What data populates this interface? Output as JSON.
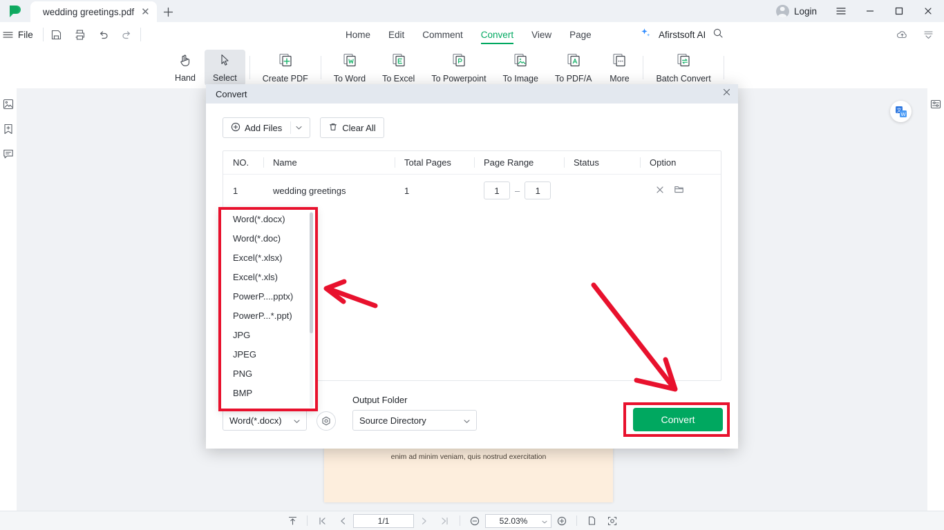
{
  "titlebar": {
    "logo_icon": "pdf-app-logo",
    "tab": {
      "label": "wedding greetings.pdf",
      "close_icon": "close-icon"
    },
    "new_tab_icon": "plus-icon",
    "login_label": "Login",
    "menu_icon": "hamburger-menu-icon",
    "minimize_icon": "minimize-icon",
    "maximize_icon": "maximize-icon",
    "close_icon": "close-icon"
  },
  "menubar": {
    "hamburger_icon": "list-menu-icon",
    "file_label": "File",
    "quick_icons": [
      "save-icon",
      "print-icon",
      "undo-icon",
      "redo-icon"
    ],
    "tabs": [
      {
        "label": "Home",
        "active": false
      },
      {
        "label": "Edit",
        "active": false
      },
      {
        "label": "Comment",
        "active": false
      },
      {
        "label": "Convert",
        "active": true
      },
      {
        "label": "View",
        "active": false
      },
      {
        "label": "Page",
        "active": false
      }
    ],
    "ai_label": "Afirstsoft AI",
    "ai_icon": "sparkle-icon",
    "search_icon": "search-icon",
    "cloud_icon": "cloud-upload-icon",
    "collapse_icon": "collapse-ribbon-icon"
  },
  "toolbar": {
    "items": [
      {
        "label": "Hand",
        "icon": "hand-icon",
        "selected": false
      },
      {
        "label": "Select",
        "icon": "cursor-arrow-icon",
        "selected": true
      },
      {
        "label": "Create PDF",
        "icon": "create-pdf-icon",
        "selected": false
      },
      {
        "label": "To Word",
        "icon": "to-word-icon",
        "selected": false
      },
      {
        "label": "To Excel",
        "icon": "to-excel-icon",
        "selected": false
      },
      {
        "label": "To Powerpoint",
        "icon": "to-powerpoint-icon",
        "selected": false
      },
      {
        "label": "To Image",
        "icon": "to-image-icon",
        "selected": false
      },
      {
        "label": "To PDF/A",
        "icon": "to-pdfa-icon",
        "selected": false
      },
      {
        "label": "More",
        "icon": "more-icon",
        "selected": false
      },
      {
        "label": "Batch Convert",
        "icon": "batch-convert-icon",
        "selected": false
      }
    ]
  },
  "left_rail": {
    "icons": [
      "thumbnail-icon",
      "bookmark-add-icon",
      "comment-icon"
    ]
  },
  "right_rail": {
    "icons": [
      "properties-sliders-icon"
    ],
    "translate_badge_icon": "translate-to-word-icon"
  },
  "document": {
    "visible_text": "enim ad minim veniam, quis nostrud exercitation",
    "page_color": "#fdeedd"
  },
  "dialog": {
    "title": "Convert",
    "close_icon": "close-icon",
    "add_files_label": "Add Files",
    "add_files_icon": "plus-circle-icon",
    "add_files_caret": "chevron-down-icon",
    "clear_all_label": "Clear All",
    "clear_all_icon": "trash-icon",
    "table": {
      "headers": [
        "NO.",
        "Name",
        "Total Pages",
        "Page Range",
        "Status",
        "Option"
      ],
      "rows": [
        {
          "no": "1",
          "name": "wedding greetings",
          "total_pages": "1",
          "range_from": "1",
          "range_to": "1",
          "range_dash": "–",
          "status": "",
          "option_icons": [
            "remove-file-icon",
            "open-folder-icon"
          ]
        }
      ]
    },
    "format_select": {
      "value": "Word(*.docx)",
      "caret_icon": "chevron-down-icon"
    },
    "settings_icon": "settings-gear-icon",
    "output_folder": {
      "label": "Output Folder",
      "value": "Source Directory",
      "caret_icon": "chevron-down-icon"
    },
    "convert_button": {
      "label": "Convert",
      "color": "#00a860"
    },
    "format_dropdown": {
      "options": [
        "Word(*.docx)",
        "Word(*.doc)",
        "Excel(*.xlsx)",
        "Excel(*.xls)",
        "PowerP....pptx)",
        "PowerP...*.ppt)",
        "JPG",
        "JPEG",
        "PNG",
        "BMP"
      ]
    }
  },
  "statusbar": {
    "fit_icon": "fit-page-icon",
    "first_icon": "first-page-icon",
    "prev_icon": "previous-page-icon",
    "page_value": "1/1",
    "next_icon": "next-page-icon",
    "last_icon": "last-page-icon",
    "zoom_out_icon": "zoom-out-icon",
    "zoom_value": "52.03%",
    "zoom_caret_icon": "chevron-down-icon",
    "zoom_in_icon": "zoom-in-icon",
    "single_page_icon": "single-page-view-icon",
    "snapshot_icon": "snapshot-icon"
  },
  "annotations": {
    "color": "#e8112d",
    "dropdown_highlight": "red-box-around-format-dropdown",
    "convert_highlight": "red-box-around-convert-button",
    "arrow_to_dropdown": "red-arrow-pointing-left",
    "arrow_to_convert": "red-arrow-pointing-down-right"
  }
}
